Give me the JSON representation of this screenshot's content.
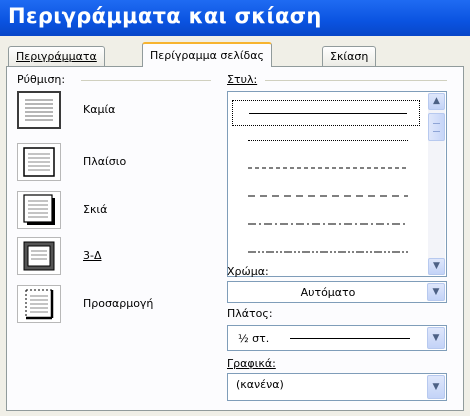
{
  "window": {
    "title": "Περιγράμματα και σκίαση"
  },
  "tabs": [
    {
      "label": "Περιγράμματα",
      "active": false
    },
    {
      "label": "Περίγραμμα σελίδας",
      "active": true
    },
    {
      "label": "Σκίαση",
      "active": false
    }
  ],
  "setting": {
    "label": "Ρύθμιση:",
    "items": [
      {
        "label": "Καμία",
        "selected": true
      },
      {
        "label": "Πλαίσιο",
        "selected": false
      },
      {
        "label": "Σκιά",
        "selected": false
      },
      {
        "label": "3-Δ",
        "selected": false
      },
      {
        "label": "Προσαρμογή",
        "selected": false
      }
    ]
  },
  "style": {
    "label": "Στυλ:",
    "options": [
      "solid",
      "dotted",
      "dashed-small",
      "dashed-large",
      "dash-dot",
      "dash-dot-dot"
    ]
  },
  "color": {
    "label": "Χρώμα:",
    "value": "Αυτόματο"
  },
  "width": {
    "label": "Πλάτος:",
    "value": "½ στ."
  },
  "art": {
    "label": "Γραφικά:",
    "value": "(κανένα)"
  },
  "colors": {
    "title_bar": "#0a53e0",
    "active_tab_accent": "#f7b430",
    "field_border": "#7f9db9"
  }
}
